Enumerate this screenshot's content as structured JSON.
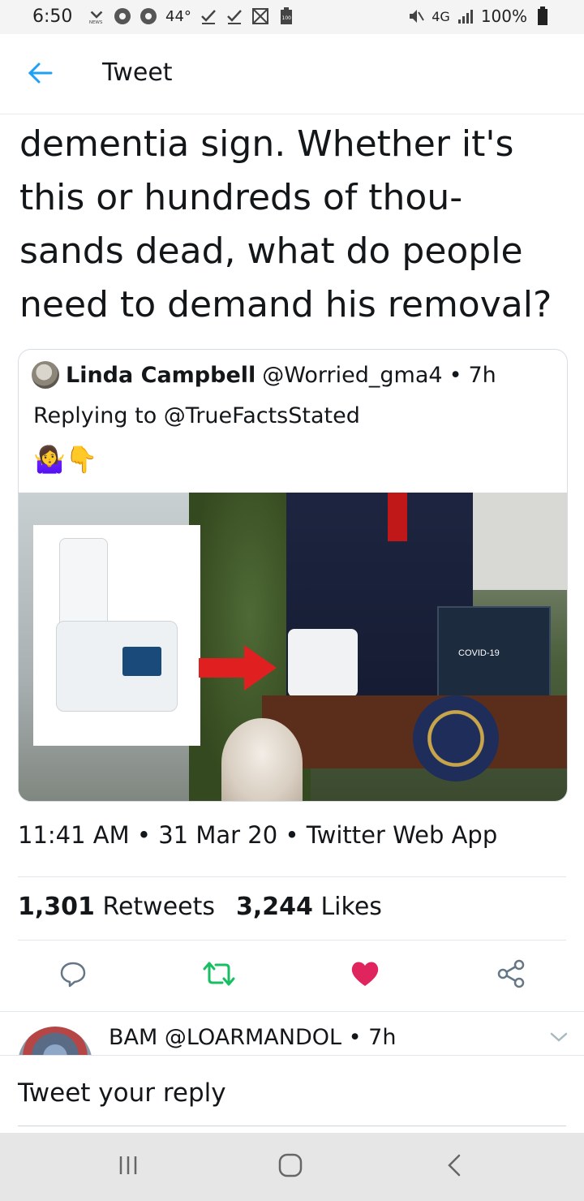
{
  "status_bar": {
    "time": "6:50",
    "temperature": "44°",
    "network": "4G",
    "battery": "100%",
    "left_icon_names": [
      "nbc-news-icon",
      "chrome-icon",
      "chrome-icon",
      "download-done-icon",
      "download-done-icon",
      "no-image-icon",
      "battery-100-icon"
    ]
  },
  "header": {
    "title": "Tweet",
    "back_icon": "arrow-left-icon"
  },
  "tweet": {
    "text": "dementia sign. Whether it's\nthis or hundreds of thou-\nsands dead, what do people\nneed to demand his removal?",
    "timestamp": "11:41 AM",
    "date": "31 Mar 20",
    "client": "Twitter Web App",
    "meta_separator": "•"
  },
  "quoted_tweet": {
    "name": "Linda Campbell",
    "handle": "@Worried_gma4",
    "age": "7h",
    "separator": "•",
    "replying_to": "Replying to @TrueFactsStated",
    "emoji": "🤷‍♀️👇",
    "image_text": "COVID-19"
  },
  "stats": {
    "retweets_count": "1,301",
    "retweets_label": "Retweets",
    "likes_count": "3,244",
    "likes_label": "Likes"
  },
  "actions": {
    "icons": [
      "reply-icon",
      "retweet-icon",
      "heart-icon",
      "share-icon"
    ],
    "retweet_color": "#17bf63",
    "like_color": "#e0245e"
  },
  "reply_preview": {
    "name": "BAM",
    "handle": "@LOARMANDOL",
    "age": "7h",
    "separator": "•"
  },
  "reply_input": {
    "placeholder": "Tweet your reply"
  },
  "colors": {
    "accent": "#1da1f2",
    "text": "#14171a",
    "divider": "#e1e8ed"
  }
}
